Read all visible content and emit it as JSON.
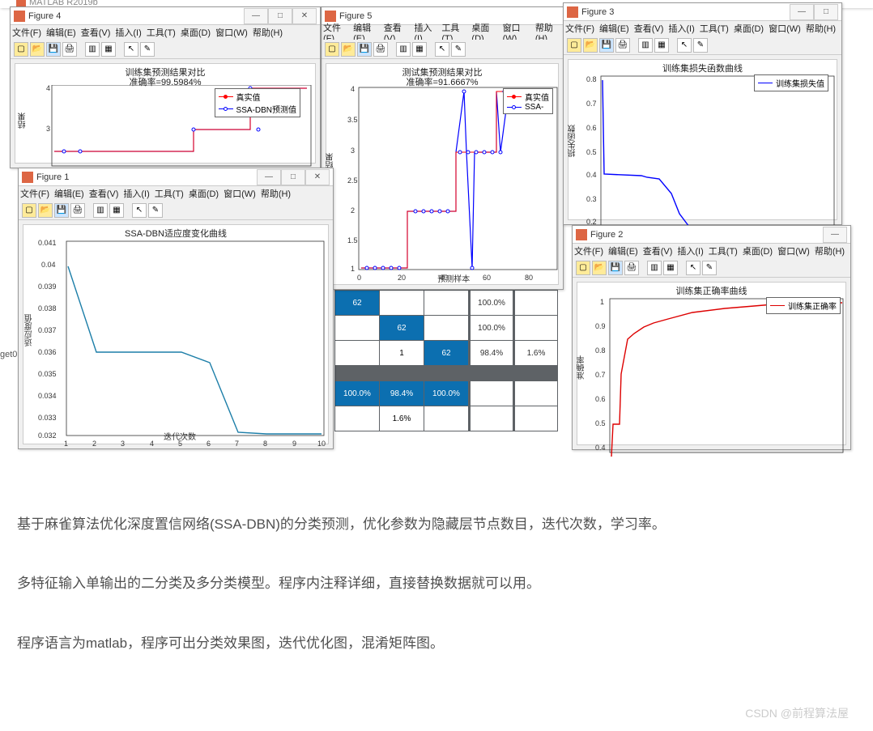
{
  "matlab_title": "MATLAB R2019b",
  "menu": {
    "file": "文件(F)",
    "edit": "编辑(E)",
    "view": "查看(V)",
    "insert": "插入(I)",
    "tools": "工具(T)",
    "desktop": "桌面(D)",
    "window": "窗口(W)",
    "help": "帮助(H)"
  },
  "win_min": "—",
  "win_max": "□",
  "win_close": "✕",
  "fig1": {
    "title": "Figure 1"
  },
  "fig2": {
    "title": "Figure 2"
  },
  "fig3": {
    "title": "Figure 3"
  },
  "fig4": {
    "title": "Figure 4"
  },
  "fig5": {
    "title": "Figure 5"
  },
  "chart_data": [
    {
      "figure": "Figure 4",
      "type": "line",
      "title": "训练集预测结果对比",
      "subtitle": "准确率=99.5984%",
      "ylabel": "结果",
      "series": [
        {
          "name": "真实值",
          "color": "red"
        },
        {
          "name": "SSA-DBN预测值",
          "color": "blue"
        }
      ],
      "xlim": [
        0,
        250
      ],
      "ylim": [
        1,
        4
      ]
    },
    {
      "figure": "Figure 5",
      "type": "line",
      "title": "测试集预测结果对比",
      "subtitle": "准确率=91.6667%",
      "xlabel": "预测样本",
      "ylabel": "预测结果",
      "series": [
        {
          "name": "真实值",
          "color": "red"
        },
        {
          "name": "SSA-",
          "color": "blue"
        }
      ],
      "xticks": [
        0,
        20,
        40,
        60,
        80
      ],
      "yticks": [
        1,
        1.5,
        2,
        2.5,
        3,
        3.5,
        4
      ],
      "xlim": [
        0,
        90
      ],
      "ylim": [
        1,
        4
      ]
    },
    {
      "figure": "Figure 3",
      "type": "line",
      "title": "训练集损失函数曲线",
      "ylabel": "损失函数",
      "series": [
        {
          "name": "训练集损失值",
          "color": "blue"
        }
      ],
      "ylim": [
        0.1,
        0.8
      ],
      "yticks": [
        0.2,
        0.3,
        0.4,
        0.5,
        0.6,
        0.7,
        0.8
      ],
      "data": [
        0.75,
        0.4,
        0.39,
        0.38,
        0.36,
        0.28,
        0.18,
        0.1
      ]
    },
    {
      "figure": "Figure 1",
      "type": "line",
      "title": "SSA-DBN适应度变化曲线",
      "xlabel": "迭代次数",
      "ylabel": "适应度值",
      "x": [
        1,
        2,
        3,
        4,
        5,
        6,
        7,
        8,
        9,
        10
      ],
      "values": [
        0.04,
        0.036,
        0.036,
        0.036,
        0.036,
        0.0355,
        0.0323,
        0.0322,
        0.0322,
        0.0322
      ],
      "xlim": [
        1,
        10
      ],
      "ylim": [
        0.032,
        0.041
      ],
      "yticks": [
        0.032,
        0.033,
        0.034,
        0.035,
        0.036,
        0.037,
        0.038,
        0.039,
        0.04,
        0.041
      ]
    },
    {
      "figure": "Confusion Matrix",
      "type": "table",
      "matrix": [
        [
          62,
          null,
          null,
          "100.0%",
          null
        ],
        [
          null,
          62,
          null,
          "100.0%",
          null
        ],
        [
          null,
          1,
          62,
          "98.4%",
          "1.6%"
        ]
      ],
      "cols": [
        "100.0%",
        "98.4%",
        "100.0%",
        "",
        ""
      ],
      "colsub": [
        "",
        "1.6%",
        "",
        "",
        ""
      ]
    },
    {
      "figure": "Figure 2",
      "type": "line",
      "title": "训练集正确率曲线",
      "ylabel": "准确率",
      "series": [
        {
          "name": "训练集正确率",
          "color": "red"
        }
      ],
      "ylim": [
        0.35,
        1.0
      ],
      "yticks": [
        0.4,
        0.5,
        0.6,
        0.7,
        0.8,
        0.9,
        1
      ],
      "data": [
        0.35,
        0.5,
        0.5,
        0.72,
        0.87,
        0.9,
        0.93,
        0.95,
        0.97,
        0.98,
        0.985,
        0.99
      ]
    }
  ],
  "cm": {
    "r1": {
      "a": "62",
      "b": "",
      "c": "",
      "p": "100.0%",
      "q": ""
    },
    "r2": {
      "a": "",
      "b": "62",
      "c": "",
      "p": "100.0%",
      "q": ""
    },
    "r3": {
      "a": "",
      "b": "1",
      "c": "62",
      "p": "98.4%",
      "q": "1.6%"
    },
    "cr": {
      "a": "100.0%",
      "b": "98.4%",
      "c": "100.0%"
    },
    "cr2": {
      "b": "1.6%"
    }
  },
  "description": {
    "p1": "基于麻雀算法优化深度置信网络(SSA-DBN)的分类预测，优化参数为隐藏层节点数目，迭代次数，学习率。",
    "p2": "多特征输入单输出的二分类及多分类模型。程序内注释详细，直接替换数据就可以用。",
    "p3": "程序语言为matlab，程序可出分类效果图，迭代优化图，混淆矩阵图。"
  },
  "watermark": "CSDN @前程算法屋",
  "get0": "get0"
}
